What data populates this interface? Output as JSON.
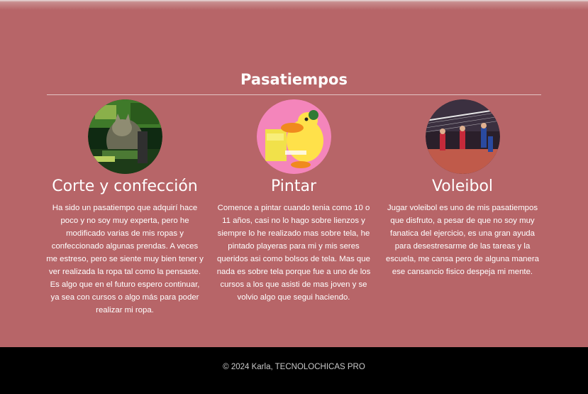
{
  "section": {
    "title": "Pasatiempos"
  },
  "cards": [
    {
      "title": "Corte y confección",
      "image_icon": "cat-sewing-photo",
      "text": "Ha sido un pasatiempo que adquirí hace poco y no soy muy experta, pero he modificado varias de mis ropas y confeccionado algunas prendas. A veces me estreso, pero se siente muy bien tener y ver realizada la ropa tal como la pensaste. Es algo que en el futuro espero continuar, ya sea con cursos o algo más para poder realizar mi ropa."
    },
    {
      "title": "Pintar",
      "image_icon": "yellow-duck-painting-photo",
      "text": "Comence a pintar cuando tenia como 10 o 11 años, casi no lo hago sobre lienzos y siempre lo he realizado mas sobre tela, he pintado playeras para mi y mis seres queridos asi como bolsos de tela. Mas que nada es sobre tela porque fue a uno de los cursos a los que asisti de mas joven y se volvio algo que segui haciendo."
    },
    {
      "title": "Voleibol",
      "image_icon": "volleyball-match-photo",
      "text": "Jugar voleibol es uno de mis pasatiempos que disfruto, a pesar de que no soy muy fanatica del ejercicio, es una gran ayuda para desestresarme de las tareas y la escuela, me cansa pero de alguna manera ese cansancio fisico despeja mi mente."
    }
  ],
  "footer": {
    "text": "© 2024 Karla, TECNOLOCHICAS PRO"
  },
  "colors": {
    "background": "#b76568",
    "footer_background": "#000000",
    "text": "#ffffff"
  }
}
